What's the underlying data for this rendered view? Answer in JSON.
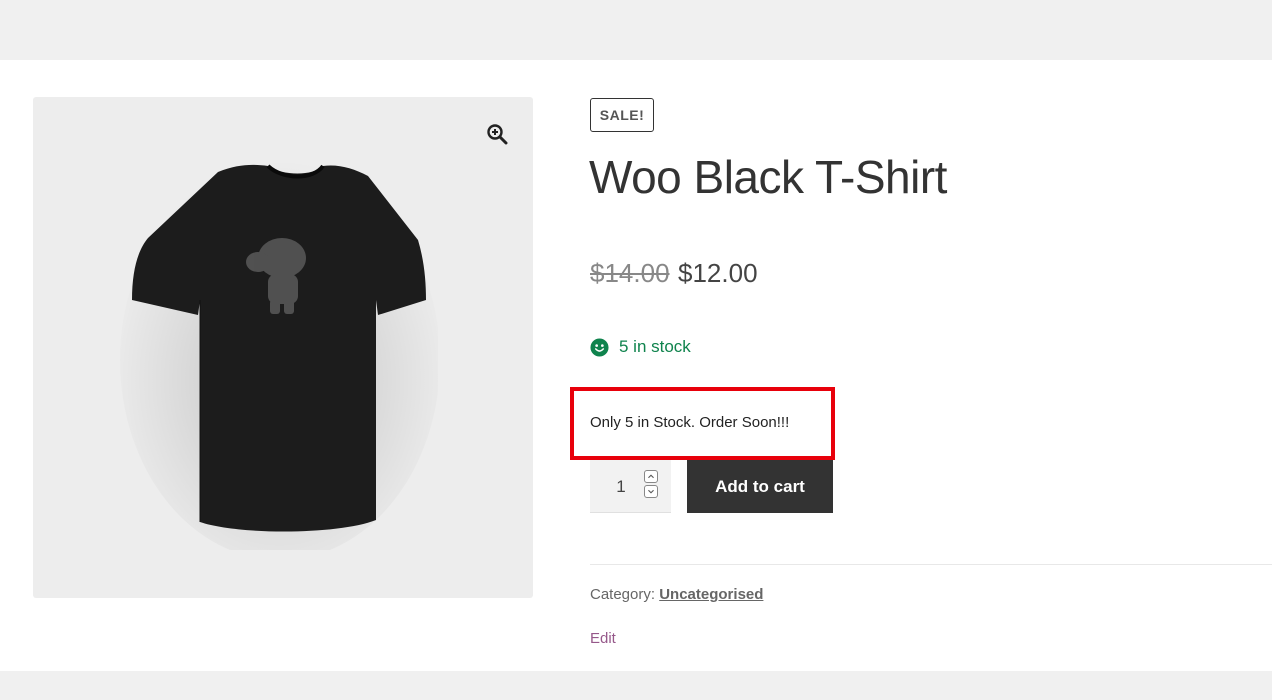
{
  "product": {
    "sale_badge": "SALE!",
    "title": "Woo Black T-Shirt",
    "price_original": "$14.00",
    "price_sale": "$12.00",
    "stock_status": "5 in stock",
    "stock_note": "Only 5 in Stock. Order Soon!!!",
    "quantity": "1",
    "add_to_cart_label": "Add to cart",
    "category_label": "Category:",
    "category_value": "Uncategorised",
    "edit_label": "Edit"
  },
  "icons": {
    "zoom": "zoom-in-icon",
    "stock": "smiley-icon",
    "qty_up": "chevron-up-icon",
    "qty_down": "chevron-down-icon"
  },
  "colors": {
    "stock_green": "#0f834d",
    "highlight_red": "#e8000b",
    "button_dark": "#333333",
    "edit_link": "#96588a"
  }
}
